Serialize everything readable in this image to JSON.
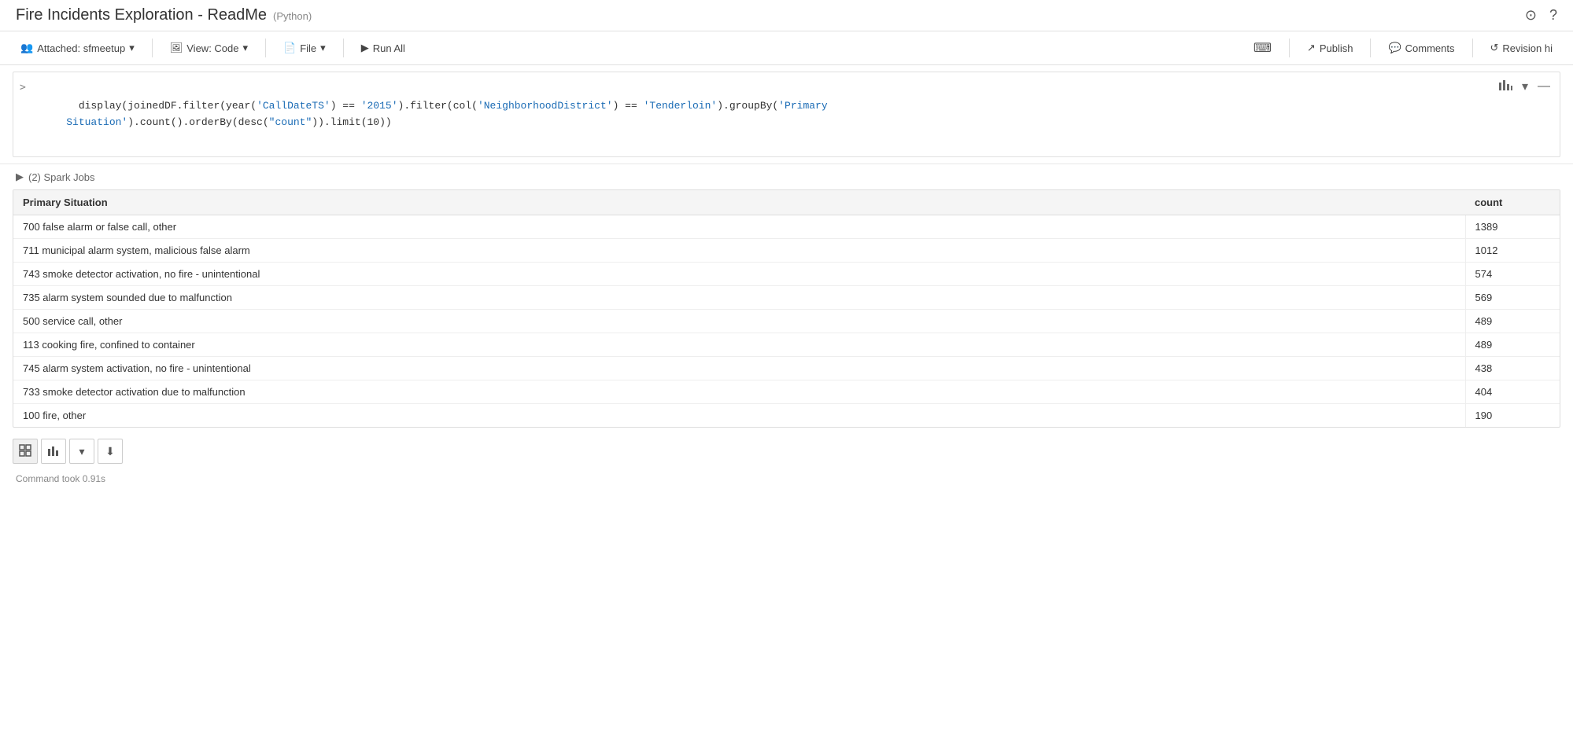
{
  "title": {
    "text": "Fire Incidents Exploration - ReadMe",
    "lang": "(Python)",
    "icons": {
      "clock": "⊙",
      "question": "?"
    }
  },
  "toolbar": {
    "attached_label": "Attached: sfmeetup",
    "view_label": "View: Code",
    "file_label": "File",
    "run_all_label": "Run All",
    "keyboard_label": "⌨",
    "publish_label": "Publish",
    "comments_label": "Comments",
    "revision_label": "Revision hi"
  },
  "cell": {
    "prompt": ">",
    "code_line1": "display(joinedDF.filter(year('CallDateTS') == '2015').filter(col('NeighborhoodDistrict') == 'Tenderloin').groupBy('Primary",
    "code_line2": "Situation').count().orderBy(desc(\"count\")).limit(10))"
  },
  "spark_jobs": {
    "arrow": "▶",
    "label": "(2) Spark Jobs"
  },
  "table": {
    "headers": [
      "Primary Situation",
      "count"
    ],
    "rows": [
      {
        "situation": "700 false alarm or false call, other",
        "count": "1389"
      },
      {
        "situation": "711 municipal alarm system, malicious false alarm",
        "count": "1012"
      },
      {
        "situation": "743 smoke detector activation, no fire - unintentional",
        "count": "574"
      },
      {
        "situation": "735 alarm system sounded due to malfunction",
        "count": "569"
      },
      {
        "situation": "500 service call, other",
        "count": "489"
      },
      {
        "situation": "113 cooking fire, confined to container",
        "count": "489"
      },
      {
        "situation": "745 alarm system activation, no fire - unintentional",
        "count": "438"
      },
      {
        "situation": "733 smoke detector activation due to malfunction",
        "count": "404"
      },
      {
        "situation": "100 fire, other",
        "count": "190"
      }
    ]
  },
  "bottom_toolbar": {
    "table_icon": "⊞",
    "chart_icon": "▦",
    "dropdown_icon": "▼",
    "download_icon": "⬇"
  },
  "status": {
    "text": "Command took 0.91s"
  }
}
